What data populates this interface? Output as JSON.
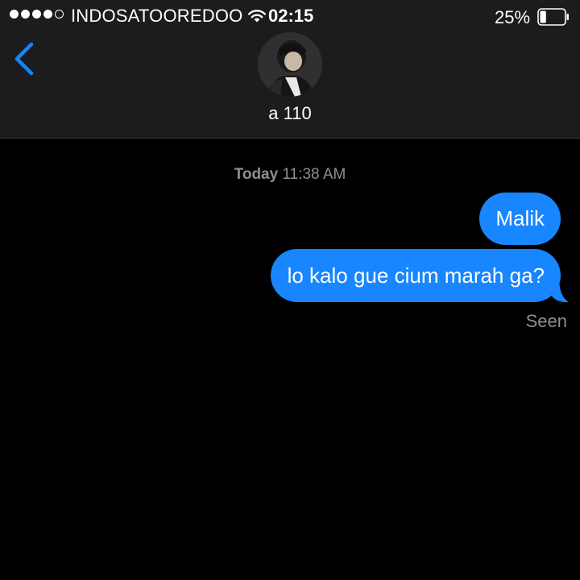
{
  "status_bar": {
    "signal_icon": "signal-dots-icon",
    "carrier": "INDOSATOOREDOO",
    "wifi_icon": "wifi-icon",
    "time": "02:15",
    "battery_percent": "25%",
    "battery_icon": "battery-icon",
    "battery_level": 0.25
  },
  "nav": {
    "back_icon": "chevron-left-icon",
    "avatar_icon": "avatar",
    "contact_name": "a 110"
  },
  "conversation": {
    "timestamp_day": "Today",
    "timestamp_time": "11:38 AM",
    "messages": [
      {
        "text": "Malik",
        "sender": "me"
      },
      {
        "text": "lo kalo gue cium marah ga?",
        "sender": "me"
      }
    ],
    "receipt": "Seen"
  },
  "colors": {
    "header_bg": "#1c1c1e",
    "bubble_blue": "#1786ff",
    "accent_blue": "#1a82f7",
    "muted_gray": "#8e8e93"
  }
}
